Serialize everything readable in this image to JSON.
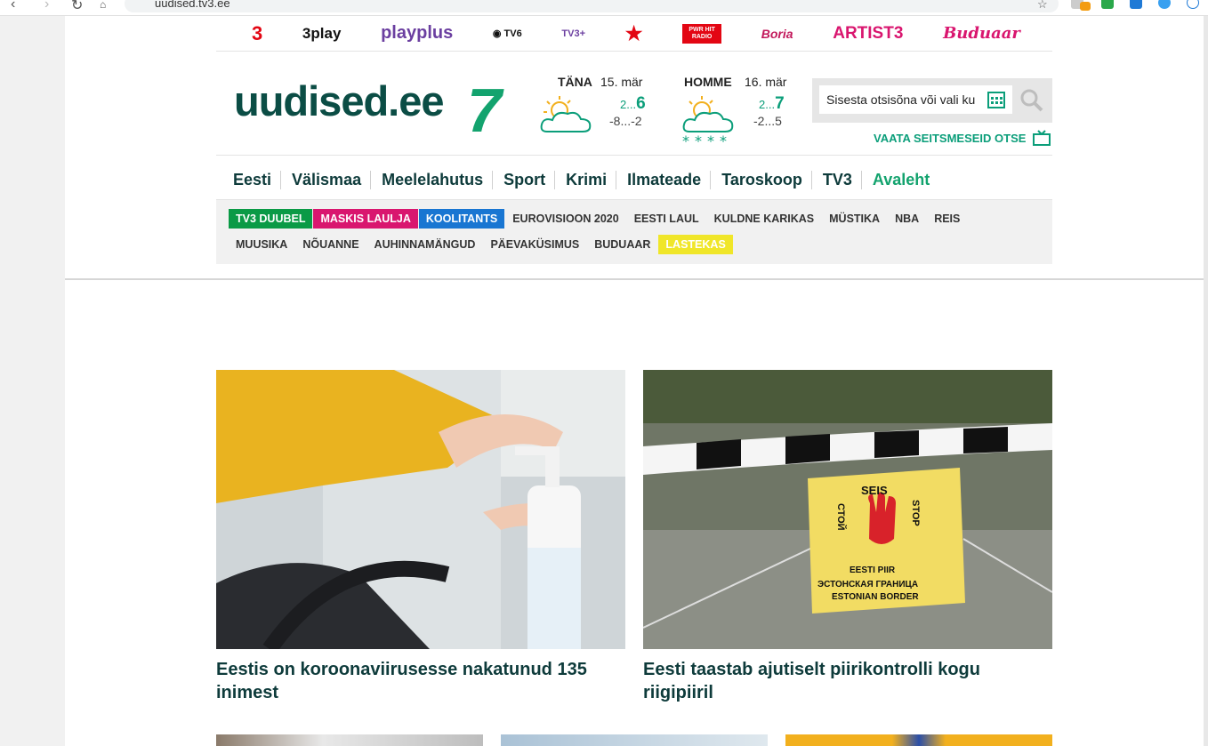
{
  "browser": {
    "url": "uudised.tv3.ee"
  },
  "brands": [
    "3",
    "3play",
    "playplus",
    "TV6",
    "TV3+",
    "STAR",
    "PWR HIT RADIO",
    "Boria",
    "ARTIST3",
    "Buduaar"
  ],
  "logo": {
    "text": "uudised.ee",
    "digit": "7"
  },
  "weather": [
    {
      "day": "TÄNA",
      "date": "15. mär",
      "hi_prefix": "2...",
      "hi": "6",
      "lo": "-8...-2"
    },
    {
      "day": "HOMME",
      "date": "16. mär",
      "hi_prefix": "2...",
      "hi": "7",
      "lo": "-2...5"
    }
  ],
  "search": {
    "placeholder": "Sisesta otsisõna või vali ku"
  },
  "watch_live": "VAATA SEITSMESEID OTSE",
  "mainnav": [
    "Eesti",
    "Välismaa",
    "Meelelahutus",
    "Sport",
    "Krimi",
    "Ilmateade",
    "Taroskoop",
    "TV3",
    "Avaleht"
  ],
  "tags": [
    {
      "label": "TV3 DUUBEL",
      "bg": "#0a9a46",
      "fg": "#ffffff"
    },
    {
      "label": "MASKIS LAULJA",
      "bg": "#d9166f",
      "fg": "#ffffff"
    },
    {
      "label": "KOOLITANTS",
      "bg": "#1976d2",
      "fg": "#ffffff"
    },
    {
      "label": "EUROVISIOON 2020",
      "bg": "",
      "fg": "#333333"
    },
    {
      "label": "EESTI LAUL",
      "bg": "",
      "fg": "#333333"
    },
    {
      "label": "KULDNE KARIKAS",
      "bg": "",
      "fg": "#333333"
    },
    {
      "label": "MÜSTIKA",
      "bg": "",
      "fg": "#333333"
    },
    {
      "label": "NBA",
      "bg": "",
      "fg": "#333333"
    },
    {
      "label": "REIS",
      "bg": "",
      "fg": "#333333"
    },
    {
      "label": "MUUSIKA",
      "bg": "",
      "fg": "#333333"
    },
    {
      "label": "NÕUANNE",
      "bg": "",
      "fg": "#333333"
    },
    {
      "label": "AUHINNAMÄNGUD",
      "bg": "",
      "fg": "#333333"
    },
    {
      "label": "PÄEVAKÜSIMUS",
      "bg": "",
      "fg": "#333333"
    },
    {
      "label": "BUDUAAR",
      "bg": "",
      "fg": "#333333"
    },
    {
      "label": "LASTEKAS",
      "bg": "#f0e629",
      "fg": "#ffffff"
    }
  ],
  "articles": [
    {
      "title": "Eestis on koroonaviirusesse nakatunud 135 inimest"
    },
    {
      "title": "Eesti taastab ajutiselt piirikontrolli kogu riigipiiril"
    }
  ],
  "sign": {
    "seis": "SEIS",
    "stop": "STOP",
    "stoi": "СТОЙ",
    "line1": "EESTI PIIR",
    "line2": "ЭСТОНСКАЯ ГРАНИЦА",
    "line3": "ESTONIAN BORDER"
  },
  "colors": {
    "accent": "#13a36e",
    "dark": "#0e3b3b"
  }
}
